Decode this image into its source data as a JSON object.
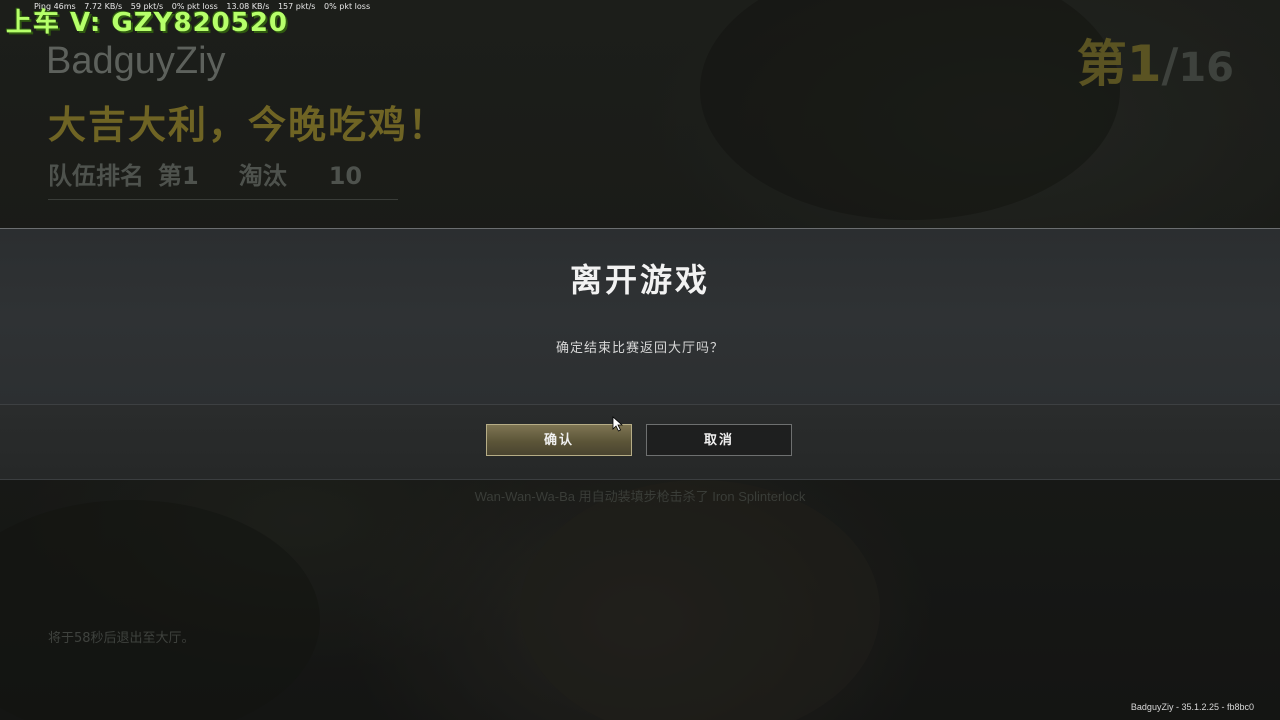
{
  "overlay": {
    "stats": [
      "Ping 46ms",
      "7.72 KB/s",
      "59 pkt/s",
      "0% pkt loss",
      "13.08 KB/s",
      "157 pkt/s",
      "0% pkt loss"
    ],
    "streamer_tag": "上车 V: GZY820520"
  },
  "results": {
    "player_name": "BadguyZiy",
    "win_title": "大吉大利，今晚吃鸡！",
    "team_rank_label": "队伍排名",
    "team_rank_value": "第1",
    "kills_label": "淘汰",
    "kills_value": "10",
    "rank_current": "第1",
    "rank_separator": "/",
    "rank_total": "16"
  },
  "dialog": {
    "title": "离开游戏",
    "message": "确定结束比赛返回大厅吗？",
    "confirm_label": "确认",
    "cancel_label": "取消"
  },
  "background": {
    "killfeed": "Wan-Wan-Wa-Ba 用自动装填步枪击杀了 Iron Splinterlock",
    "auto_exit": "将于58秒后退出至大厅。",
    "build_info": "BadguyZiy - 35.1.2.25 - fb8bc0"
  },
  "colors": {
    "win_gold": "#6f6424",
    "confirm_button": "#6b6446",
    "streamer_green": "#b6ff6a"
  }
}
